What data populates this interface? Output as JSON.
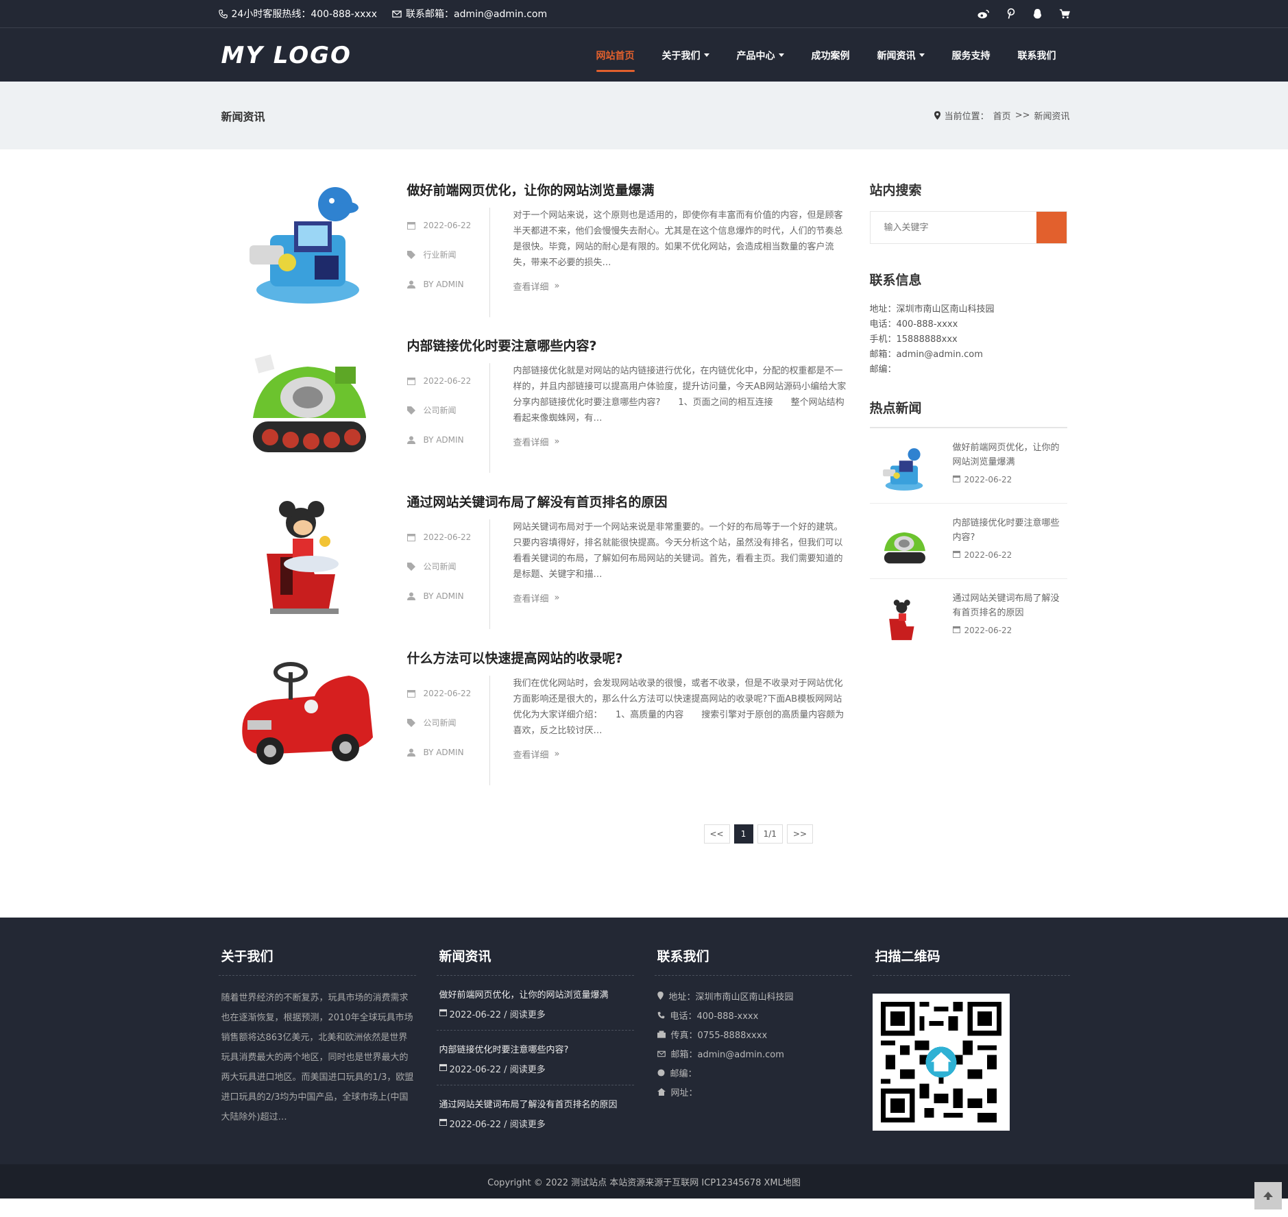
{
  "topbar": {
    "hotline": "24小时客服热线：400-888-xxxx",
    "email": "联系邮箱：admin@admin.com",
    "icons": [
      "weibo-icon",
      "pinterest-icon",
      "qq-icon",
      "cart-icon"
    ]
  },
  "header": {
    "logo": "MY LOGO",
    "nav": [
      {
        "label": "网站首页",
        "active": true,
        "dropdown": false
      },
      {
        "label": "关于我们",
        "active": false,
        "dropdown": true
      },
      {
        "label": "产品中心",
        "active": false,
        "dropdown": true
      },
      {
        "label": "成功案例",
        "active": false,
        "dropdown": false
      },
      {
        "label": "新闻资讯",
        "active": false,
        "dropdown": true
      },
      {
        "label": "服务支持",
        "active": false,
        "dropdown": false
      },
      {
        "label": "联系我们",
        "active": false,
        "dropdown": false
      }
    ]
  },
  "banner": {
    "title": "新闻资讯",
    "breadcrumb_prefix": "当前位置：",
    "breadcrumb_home": "首页",
    "breadcrumb_sep": ">>",
    "breadcrumb_current": "新闻资讯"
  },
  "articles": [
    {
      "title": "做好前端网页优化，让你的网站浏览量爆满",
      "date": "2022-06-22",
      "category": "行业新闻",
      "author": "BY ADMIN",
      "excerpt": "对于一个网站来说，这个原则也是适用的，即使你有丰富而有价值的内容，但是顾客半天都进不来，他们会慢慢失去耐心。尤其是在这个信息爆炸的时代，人们的节奏总是很快。毕竟，网站的耐心是有限的。如果不优化网站，会造成相当数量的客户流失，带来不必要的损失…",
      "more": "查看详细",
      "image": "dolphin-ride"
    },
    {
      "title": "内部链接优化时要注意哪些内容?",
      "date": "2022-06-22",
      "category": "公司新闻",
      "author": "BY ADMIN",
      "excerpt": "内部链接优化就是对网站的站内链接进行优化，在内链优化中，分配的权重都是不一样的，并且内部链接可以提高用户体验度，提升访问量，今天AB网站源码小编给大家分享内部链接优化时要注意哪些内容?　　1、页面之间的相互连接　　整个网站结构看起来像蜘蛛网，有…",
      "more": "查看详细",
      "image": "tank-ride"
    },
    {
      "title": "通过网站关键词布局了解没有首页排名的原因",
      "date": "2022-06-22",
      "category": "公司新闻",
      "author": "BY ADMIN",
      "excerpt": "网站关键词布局对于一个网站来说是非常重要的。一个好的布局等于一个好的建筑。只要内容填得好，排名就能很快提高。今天分析这个站，虽然没有排名，但我们可以看看关键词的布局，了解如何布局网站的关键词。首先，看看主页。我们需要知道的是标题、关键字和描…",
      "more": "查看详细",
      "image": "mouse-ride"
    },
    {
      "title": "什么方法可以快速提高网站的收录呢?",
      "date": "2022-06-22",
      "category": "公司新闻",
      "author": "BY ADMIN",
      "excerpt": "我们在优化网站时，会发现网站收录的很慢，或者不收录，但是不收录对于网站优化方面影响还是很大的，那么什么方法可以快速提高网站的收录呢?下面AB模板网网站优化为大家详细介绍：　　1、高质量的内容　　搜索引擎对于原创的高质量内容颇为喜欢，反之比较讨厌…",
      "more": "查看详细",
      "image": "car-ride"
    }
  ],
  "pager": {
    "prev": "<<",
    "current": "1",
    "total": "1/1",
    "next": ">>"
  },
  "sidebar": {
    "search_title": "站内搜索",
    "search_placeholder": "输入关键字",
    "contact_title": "联系信息",
    "contact_lines": [
      "地址：深圳市南山区南山科技园",
      "电话：400-888-xxxx",
      "手机：15888888xxx",
      "邮箱：admin@admin.com",
      "邮编："
    ],
    "hot_title": "热点新闻",
    "hot": [
      {
        "title": "做好前端网页优化，让你的网站浏览量爆满",
        "date": "2022-06-22",
        "image": "dolphin-ride"
      },
      {
        "title": "内部链接优化时要注意哪些内容?",
        "date": "2022-06-22",
        "image": "tank-ride"
      },
      {
        "title": "通过网站关键词布局了解没有首页排名的原因",
        "date": "2022-06-22",
        "image": "mouse-ride"
      }
    ]
  },
  "footer": {
    "about_title": "关于我们",
    "about_text": "随着世界经济的不断复苏，玩具市场的消费需求也在逐渐恢复，根据预测，2010年全球玩具市场销售额将达863亿美元，北美和欧洲依然是世界玩具消费最大的两个地区，同时也是世界最大的两大玩具进口地区。而美国进口玩具的1/3，欧盟进口玩具的2/3均为中国产品，全球市场上(中国大陆除外)超过…",
    "news_title": "新闻资讯",
    "news": [
      {
        "title": "做好前端网页优化，让你的网站浏览量爆满",
        "date": "2022-06-22 / 阅读更多"
      },
      {
        "title": "内部链接优化时要注意哪些内容?",
        "date": "2022-06-22 / 阅读更多"
      },
      {
        "title": "通过网站关键词布局了解没有首页排名的原因",
        "date": "2022-06-22 / 阅读更多"
      }
    ],
    "contact_title": "联系我们",
    "contact": [
      {
        "icon": "map-marker-icon",
        "text": "地址：深圳市南山区南山科技园"
      },
      {
        "icon": "phone-icon",
        "text": "电话：400-888-xxxx"
      },
      {
        "icon": "fax-icon",
        "text": "传真：0755-8888xxxx"
      },
      {
        "icon": "envelope-icon",
        "text": "邮箱：admin@admin.com"
      },
      {
        "icon": "globe-icon",
        "text": "邮编："
      },
      {
        "icon": "home-icon",
        "text": "网址："
      }
    ],
    "qr_title": "扫描二维码",
    "copyright": "Copyright © 2022 测试站点 本站资源来源于互联网 ICP12345678 XML地图"
  },
  "colors": {
    "dark": "#232834",
    "accent": "#e2602d",
    "banner": "#eef1f3"
  }
}
